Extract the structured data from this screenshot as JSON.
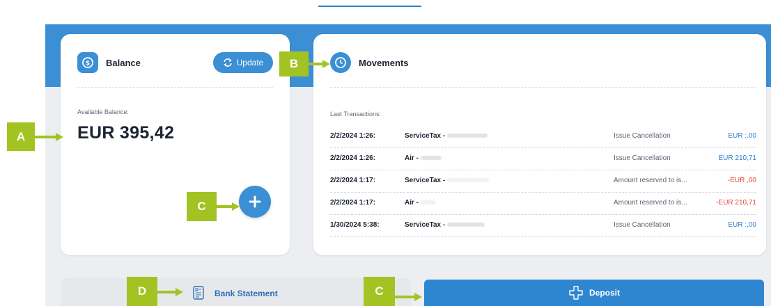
{
  "balance": {
    "title": "Balance",
    "update_label": "Update",
    "available_label": "Available Balance:",
    "amount": "EUR 395,42",
    "icon": "dollar-coin-icon"
  },
  "movements": {
    "title": "Movements",
    "icon": "clock-icon",
    "last_transactions_label": "Last Transactions:",
    "transactions": [
      {
        "date": "2/2/2024 1:26:",
        "desc": "ServiceTax -",
        "type": "Issue Cancellation",
        "amount": "EUR :.00",
        "sign": "pos"
      },
      {
        "date": "2/2/2024 1:26:",
        "desc": "Air -",
        "type": "Issue Cancellation",
        "amount": "EUR 210,71",
        "sign": "pos"
      },
      {
        "date": "2/2/2024 1:17:",
        "desc": "ServiceTax -",
        "type": "Amount reserved to is...",
        "amount": "-EUR ,00",
        "sign": "neg"
      },
      {
        "date": "2/2/2024 1:17:",
        "desc": "Air -",
        "type": "Amount reserved to is...",
        "amount": "-EUR 210,71",
        "sign": "neg"
      },
      {
        "date": "1/30/2024 5:38:",
        "desc": "ServiceTax -",
        "type": "Issue Cancellation",
        "amount": "EUR :,00",
        "sign": "pos"
      }
    ]
  },
  "actions": {
    "bank_statement_label": "Bank Statement",
    "deposit_label": "Deposit"
  },
  "callouts": {
    "a": "A",
    "b": "B",
    "c1": "C",
    "c2": "C",
    "d": "D"
  },
  "colors": {
    "primary": "#3b8fd4",
    "callout": "#a3c322",
    "negative": "#e8413b"
  }
}
